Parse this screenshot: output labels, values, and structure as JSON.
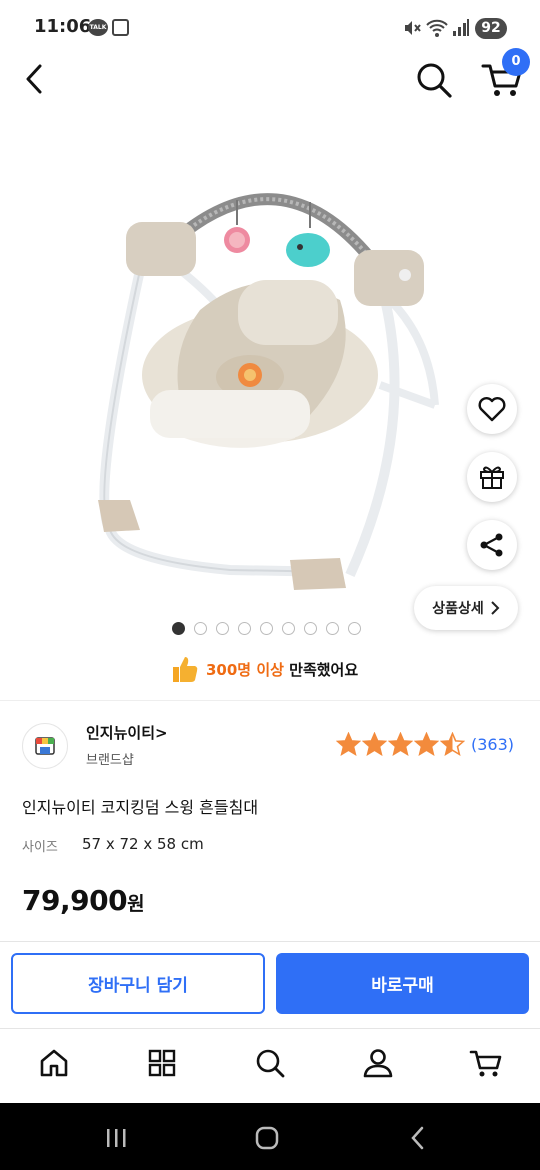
{
  "status_bar": {
    "time": "11:06",
    "talk_label": "TALK",
    "battery": "92"
  },
  "header": {
    "cart_count": "0"
  },
  "gallery": {
    "image_name": "baby-swing-product-photo",
    "total_images": 9,
    "active_index": 0
  },
  "actions": {
    "detail_label": "상품상세"
  },
  "satisfaction": {
    "count_text": "300명 이상",
    "text": " 만족했어요"
  },
  "brand": {
    "name": "인지뉴이티",
    "shop_label": "브랜드샵"
  },
  "rating": {
    "score": 4.5,
    "max": 5,
    "count": "(363)"
  },
  "product": {
    "title": "인지뉴이티 코지킹덤 스윙 흔들침대",
    "size_label": "사이즈",
    "size_value": "57 x 72 x 58 cm",
    "price": "79,900",
    "price_unit": "원"
  },
  "buttons": {
    "add_to_cart": "장바구니 담기",
    "buy_now": "바로구매"
  },
  "colors": {
    "accent": "#2f6ff6",
    "highlight": "#ef6b13",
    "star": "#f38b3c"
  },
  "icons": [
    "back-icon",
    "search-icon",
    "cart-icon",
    "heart-icon",
    "gift-icon",
    "share-icon",
    "thumbs-up-icon",
    "home-icon",
    "category-icon",
    "user-icon"
  ]
}
